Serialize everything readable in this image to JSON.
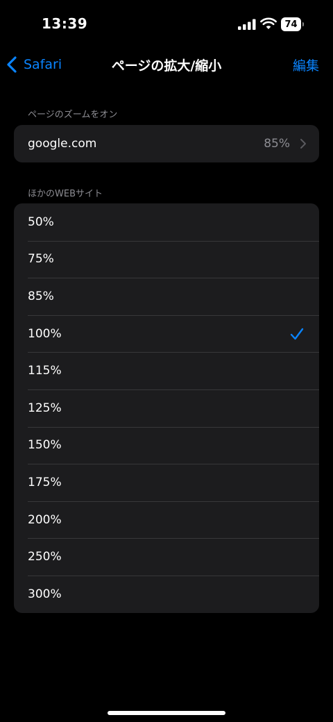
{
  "status_bar": {
    "time": "13:39",
    "battery_level": "74",
    "icons": [
      "signal-icon",
      "wifi-icon",
      "battery-icon"
    ]
  },
  "nav": {
    "back_label": "Safari",
    "title": "ページの拡大/縮小",
    "edit_label": "編集"
  },
  "colors": {
    "accent": "#0a84ff",
    "background": "#000000",
    "group_background": "#1c1c1e",
    "secondary_text": "#8d8d93"
  },
  "per_site": {
    "header": "ページのズームをオン",
    "sites": [
      {
        "domain": "google.com",
        "zoom": "85%"
      }
    ]
  },
  "other_sites": {
    "header": "ほかのWEBサイト",
    "selected_index": 3,
    "options": [
      {
        "label": "50%"
      },
      {
        "label": "75%"
      },
      {
        "label": "85%"
      },
      {
        "label": "100%"
      },
      {
        "label": "115%"
      },
      {
        "label": "125%"
      },
      {
        "label": "150%"
      },
      {
        "label": "175%"
      },
      {
        "label": "200%"
      },
      {
        "label": "250%"
      },
      {
        "label": "300%"
      }
    ]
  }
}
